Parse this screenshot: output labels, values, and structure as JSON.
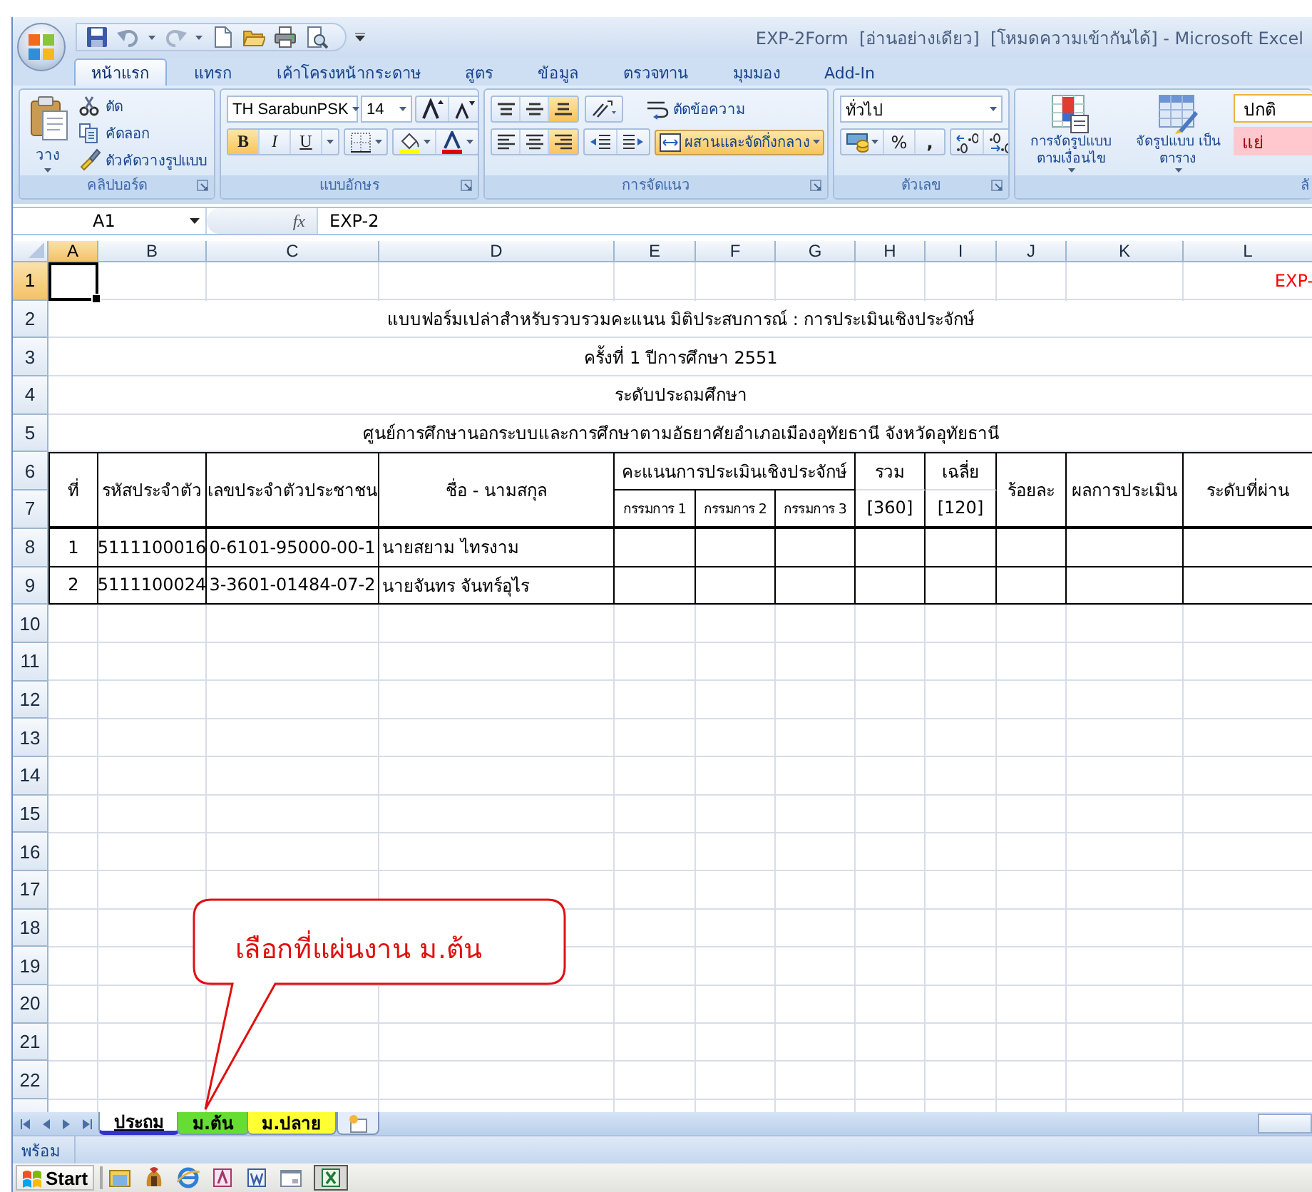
{
  "window": {
    "title": "EXP-2Form  [อ่านอย่างเดียว]  [โหมดความเข้ากันได้] - Microsoft Excel"
  },
  "ribbon_tabs": [
    {
      "label": "หน้าแรก",
      "selected": true
    },
    {
      "label": "แทรก",
      "selected": false
    },
    {
      "label": "เค้าโครงหน้ากระดาษ",
      "selected": false
    },
    {
      "label": "สูตร",
      "selected": false
    },
    {
      "label": "ข้อมูล",
      "selected": false
    },
    {
      "label": "ตรวจทาน",
      "selected": false
    },
    {
      "label": "มุมมอง",
      "selected": false
    },
    {
      "label": "Add-In",
      "selected": false
    }
  ],
  "ribbon": {
    "clipboard": {
      "label": "คลิปบอร์ด",
      "paste": "วาง",
      "cut": "ตัด",
      "copy": "คัดลอก",
      "format_painter": "ตัวคัดวางรูปแบบ"
    },
    "font": {
      "label": "แบบอักษร",
      "font_name": "TH SarabunPSK",
      "font_size": "14",
      "styles": [
        {
          "kind": "bold",
          "label": "B",
          "on": true
        },
        {
          "kind": "italic",
          "label": "I",
          "on": false
        },
        {
          "kind": "underline",
          "label": "U",
          "on": false
        }
      ]
    },
    "alignment": {
      "label": "การจัดแนว",
      "vertical": [
        {
          "kind": "top",
          "selected": false
        },
        {
          "kind": "middle",
          "selected": false
        },
        {
          "kind": "bottom",
          "selected": true
        }
      ],
      "horizontal": [
        {
          "kind": "left",
          "selected": false
        },
        {
          "kind": "center",
          "selected": false
        },
        {
          "kind": "right",
          "selected": true
        }
      ],
      "wrap_text": "ตัดข้อความ",
      "merge": {
        "label": "ผสานและจัดกึ่งกลาง",
        "on": true
      }
    },
    "number": {
      "label": "ตัวเลข",
      "format": "ทั่วไป",
      "percent": "%",
      "comma": ","
    },
    "styles": {
      "label": "ลั",
      "conditional_formatting": "การจัดรูปแบบ ตามเงื่อนไข",
      "format_as_table": "จัดรูปแบบ เป็นตาราง",
      "cell_styles": [
        {
          "kind": "normal",
          "label": "ปกติ"
        },
        {
          "kind": "bad",
          "label": "แย่"
        }
      ]
    }
  },
  "formula_bar": {
    "name_box": "A1",
    "function_label": "fx",
    "formula": "EXP-2"
  },
  "sheet": {
    "columns": [
      {
        "label": "A",
        "selected": true
      },
      {
        "label": "B",
        "selected": false
      },
      {
        "label": "C",
        "selected": false
      },
      {
        "label": "D",
        "selected": false
      },
      {
        "label": "E",
        "selected": false
      },
      {
        "label": "F",
        "selected": false
      },
      {
        "label": "G",
        "selected": false
      },
      {
        "label": "H",
        "selected": false
      },
      {
        "label": "I",
        "selected": false
      },
      {
        "label": "J",
        "selected": false
      },
      {
        "label": "K",
        "selected": false
      },
      {
        "label": "L",
        "selected": false
      }
    ],
    "rows": [
      {
        "label": "1",
        "selected": true
      },
      {
        "label": "2",
        "selected": false
      },
      {
        "label": "3",
        "selected": false
      },
      {
        "label": "4",
        "selected": false
      },
      {
        "label": "5",
        "selected": false
      },
      {
        "label": "6",
        "selected": false
      },
      {
        "label": "7",
        "selected": false
      },
      {
        "label": "8",
        "selected": false
      },
      {
        "label": "9",
        "selected": false
      },
      {
        "label": "10",
        "selected": false
      },
      {
        "label": "11",
        "selected": false
      },
      {
        "label": "12",
        "selected": false
      },
      {
        "label": "13",
        "selected": false
      },
      {
        "label": "14",
        "selected": false
      },
      {
        "label": "15",
        "selected": false
      },
      {
        "label": "16",
        "selected": false
      },
      {
        "label": "17",
        "selected": false
      },
      {
        "label": "18",
        "selected": false
      },
      {
        "label": "19",
        "selected": false
      },
      {
        "label": "20",
        "selected": false
      },
      {
        "label": "21",
        "selected": false
      },
      {
        "label": "22",
        "selected": false
      }
    ],
    "corner_note": "EXP-",
    "title_lines": [
      "แบบฟอร์มเปล่าสำหรับรวบรวมคะแนน มิติประสบการณ์ : การประเมินเชิงประจักษ์",
      "ครั้งที่ 1 ปีการศึกษา 2551",
      "ระดับประถมศึกษา",
      "ศูนย์การศึกษานอกระบบและการศึกษาตามอัธยาศัยอำเภอเมืองอุทัยธานี จังหวัดอุทัยธานี"
    ],
    "table_header": {
      "no": "ที่",
      "student_id": "รหัสประจำตัว",
      "citizen_id": "เลขประจำตัวประชาชน",
      "name": "ชื่อ - นามสกุล",
      "score_group": "คะแนนการประเมินเชิงประจักษ์",
      "judges": [
        "กรรมการ 1",
        "กรรมการ 2",
        "กรรมการ 3"
      ],
      "total": "รวม",
      "total_max": "[360]",
      "average": "เฉลี่ย",
      "average_max": "[120]",
      "percent": "ร้อยละ",
      "result": "ผลการประเมิน",
      "level_passed": "ระดับที่ผ่าน"
    },
    "data_rows": [
      {
        "no": "1",
        "student_id": "5111100016",
        "citizen_id": "0-6101-95000-00-1",
        "name": "นายสยาม  ไทรงาม"
      },
      {
        "no": "2",
        "student_id": "5111100024",
        "citizen_id": "3-3601-01484-07-2",
        "name": "นายจันทร  จันทร์อุไร"
      }
    ]
  },
  "callout": {
    "text": "เลือกที่แผ่นงาน ม.ต้น"
  },
  "sheet_tabs": [
    {
      "label": "ประถม",
      "selected": true,
      "color": "#3333cc"
    },
    {
      "label": "ม.ต้น",
      "selected": false,
      "color": "#66dd33"
    },
    {
      "label": "ม.ปลาย",
      "selected": false,
      "color": "#ffff33"
    }
  ],
  "status_bar": {
    "text": "พร้อม"
  },
  "taskbar": {
    "start": "Start"
  }
}
